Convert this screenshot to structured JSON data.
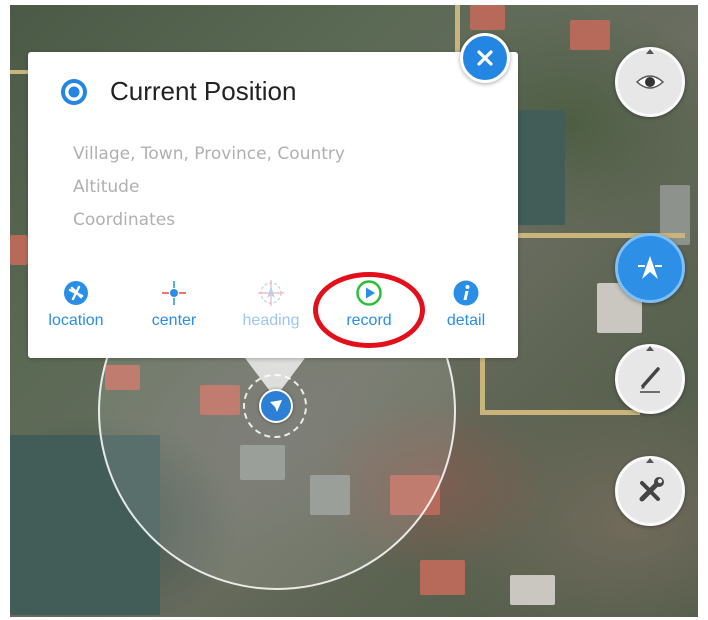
{
  "popup": {
    "title": "Current Position",
    "lines": {
      "location": "Village, Town, Province, Country",
      "altitude": "Altitude",
      "coordinates": "Coordinates"
    },
    "actions": {
      "location": "location",
      "center": "center",
      "heading": "heading",
      "record": "record",
      "detail": "detail"
    }
  },
  "icons": {
    "title": "radio-dot-icon",
    "location": "airplane-icon",
    "center": "crosshair-icon",
    "heading": "compass-icon",
    "record": "play-icon",
    "detail": "info-icon",
    "close": "close-icon",
    "eye": "eye-icon",
    "navigation": "navigation-icon",
    "draw": "pencil-icon",
    "tools": "tools-icon"
  },
  "colors": {
    "accent": "#2486e3",
    "record_green": "#2bbf3b",
    "highlight_red": "#e3101b",
    "info_text": "#b0b0b0"
  }
}
